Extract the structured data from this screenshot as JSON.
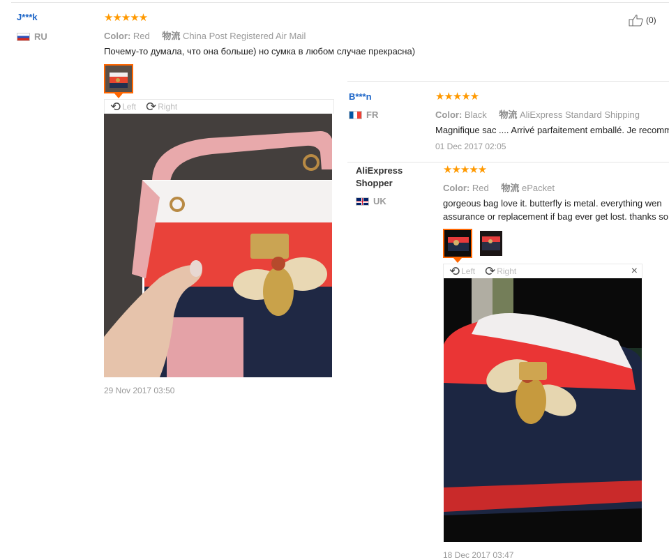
{
  "reviews": [
    {
      "name": "J***k",
      "country": "RU",
      "stars": "★★★★★",
      "color_label": "Color:",
      "color_value": "Red",
      "ship_label": "物流",
      "ship_value": "China Post Registered Air Mail",
      "text": "Почему-то думала, что она больше) но сумка в любом случае прекрасна)",
      "toolbar_left": "Left",
      "toolbar_right": "Right",
      "date": "29 Nov 2017 03:50",
      "likes": "(0)"
    },
    {
      "name": "B***n",
      "country": "FR",
      "stars": "★★★★★",
      "color_label": "Color:",
      "color_value": "Black",
      "ship_label": "物流",
      "ship_value": "AliExpress Standard Shipping",
      "text": "Magnifique sac .... Arrivé parfaitement emballé. Je recomm",
      "date": "01 Dec 2017 02:05"
    },
    {
      "name_line1": "AliExpress",
      "name_line2": "Shopper",
      "country": "UK",
      "stars": "★★★★★",
      "color_label": "Color:",
      "color_value": "Red",
      "ship_label": "物流",
      "ship_value": "ePacket",
      "text_line1": "gorgeous bag love it. butterfly is metal. everything wen",
      "text_line2": "assurance or replacement if bag ever get lost. thanks so",
      "toolbar_left": "Left",
      "toolbar_right": "Right",
      "close": "×",
      "date": "18 Dec 2017 03:47"
    }
  ],
  "icons": {
    "rotate_left": "⟲",
    "rotate_right": "⟳",
    "thumbs_up": "thumbs-up-icon"
  }
}
